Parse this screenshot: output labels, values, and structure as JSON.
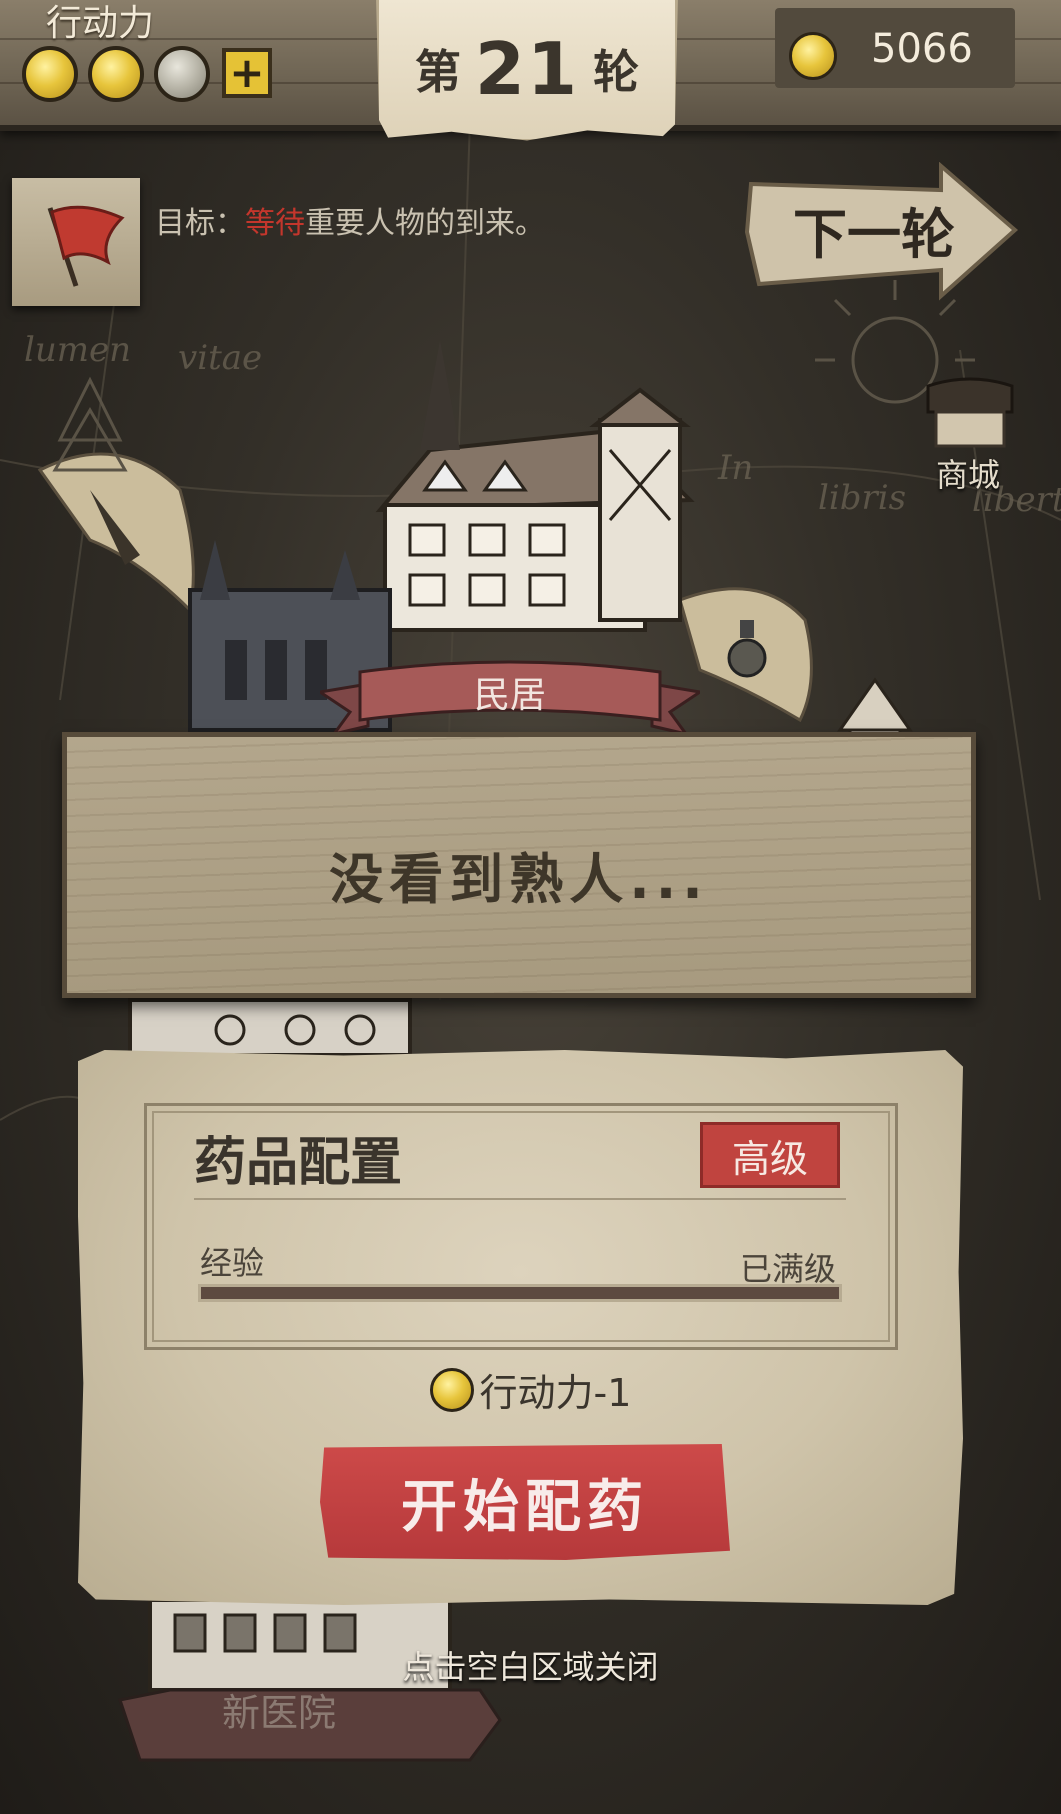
{
  "header": {
    "action_points_label": "行动力",
    "action_points": {
      "filled": 2,
      "total": 3
    },
    "add_button_label": "+",
    "round_prefix": "第",
    "round_number": "21",
    "round_suffix": "轮",
    "gold": "5066"
  },
  "objective": {
    "prefix": "目标：",
    "highlight": "等待",
    "rest": "重要人物的到来。"
  },
  "next_round_label": "下一轮",
  "shop_label": "商城",
  "map_text": {
    "word1": "lumen",
    "word2": "vitae",
    "word3": "In",
    "word4": "libris",
    "word5": "libert"
  },
  "location": {
    "name": "民居",
    "message": "没看到熟人..."
  },
  "recipe_panel": {
    "title": "药品配置",
    "tier": "高级",
    "exp_label": "经验",
    "exp_status": "已满级",
    "exp_progress": 1.0,
    "cost_text": "行动力-1",
    "start_button": "开始配药"
  },
  "close_hint": "点击空白区域关闭",
  "bottom_location": "新医院",
  "colors": {
    "accent_red": "#c4362c",
    "gold": "#e7c53c",
    "parchment": "#d6ccb4",
    "wood": "#a89b80"
  }
}
